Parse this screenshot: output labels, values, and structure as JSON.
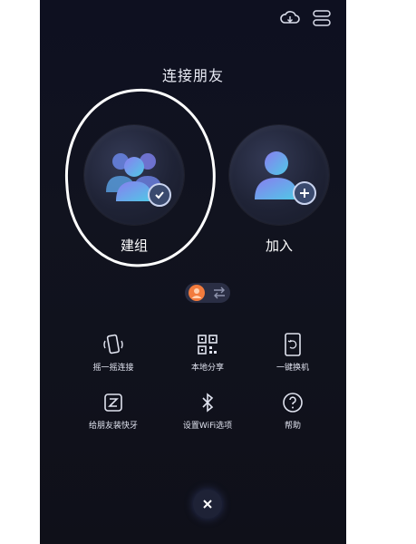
{
  "header": {
    "title": "连接朋友",
    "icons": [
      "cloud-sync-icon",
      "toggle-icon"
    ]
  },
  "actions": {
    "create_group_label": "建组",
    "join_label": "加入"
  },
  "grid": [
    {
      "label": "摇一摇连接",
      "icon": "shake-phone-icon"
    },
    {
      "label": "本地分享",
      "icon": "qr-code-icon"
    },
    {
      "label": "一键换机",
      "icon": "phone-clone-icon"
    },
    {
      "label": "给朋友装快牙",
      "icon": "install-app-icon"
    },
    {
      "label": "设置WiFi选项",
      "icon": "bluetooth-icon"
    },
    {
      "label": "帮助",
      "icon": "help-icon"
    }
  ],
  "colors": {
    "background": "#11131f",
    "people_gradient_start": "#7a7ee6",
    "people_gradient_end": "#54c7e8"
  }
}
